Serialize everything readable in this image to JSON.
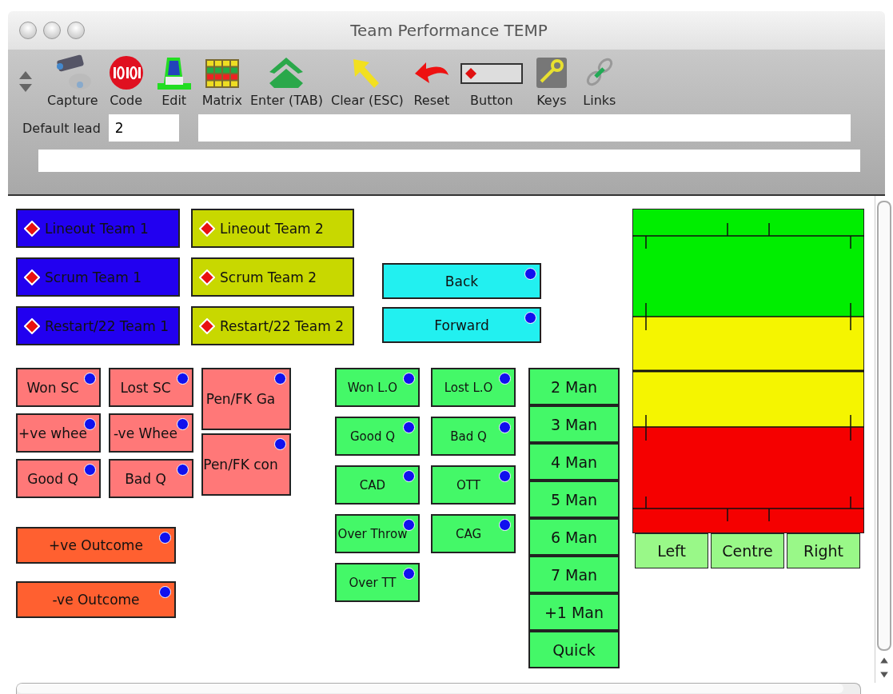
{
  "window": {
    "title": "Team Performance TEMP"
  },
  "toolbar": [
    {
      "label": "Capture",
      "kind": "camera"
    },
    {
      "label": "Code",
      "kind": "code"
    },
    {
      "label": "Edit",
      "kind": "edit"
    },
    {
      "label": "Matrix",
      "kind": "matrix"
    },
    {
      "label": "Enter (TAB)",
      "kind": "enter"
    },
    {
      "label": "Clear (ESC)",
      "kind": "clear"
    },
    {
      "label": "Reset",
      "kind": "reset"
    },
    {
      "label": "Button",
      "kind": "button"
    },
    {
      "label": "Keys",
      "kind": "keys"
    },
    {
      "label": "Links",
      "kind": "links"
    }
  ],
  "default_lead": {
    "label": "Default lead",
    "value": "2"
  },
  "set_buttons": [
    {
      "label": "Lineout Team 1",
      "color": "#2200f0"
    },
    {
      "label": "Scrum Team 1",
      "color": "#2200f0"
    },
    {
      "label": "Restart/22 Team 1",
      "color": "#2200f0"
    },
    {
      "label": "Lineout Team 2",
      "color": "#c8d800"
    },
    {
      "label": "Scrum Team 2",
      "color": "#c8d800"
    },
    {
      "label": "Restart/22 Team 2",
      "color": "#c8d800"
    }
  ],
  "direction_buttons": [
    "Back",
    "Forward"
  ],
  "scrum_columns": [
    [
      "Won SC",
      "+ve whee",
      "Good Q"
    ],
    [
      "Lost SC",
      "-ve Whee",
      "Bad Q"
    ],
    [
      "Pen/FK Ga",
      "Pen/FK con"
    ]
  ],
  "outcome_buttons": [
    "+ve Outcome",
    "-ve Outcome"
  ],
  "lineout_columns": [
    [
      "Won L.O",
      "Good Q",
      "CAD",
      "Over Throw",
      "Over TT"
    ],
    [
      "Lost L.O",
      "Bad Q",
      "OTT",
      "CAG"
    ]
  ],
  "man_buttons": [
    "2 Man",
    "3 Man",
    "4 Man",
    "5 Man",
    "6 Man",
    "7 Man",
    "+1 Man",
    "Quick"
  ],
  "zone_buttons": [
    "Left",
    "Centre",
    "Right"
  ]
}
